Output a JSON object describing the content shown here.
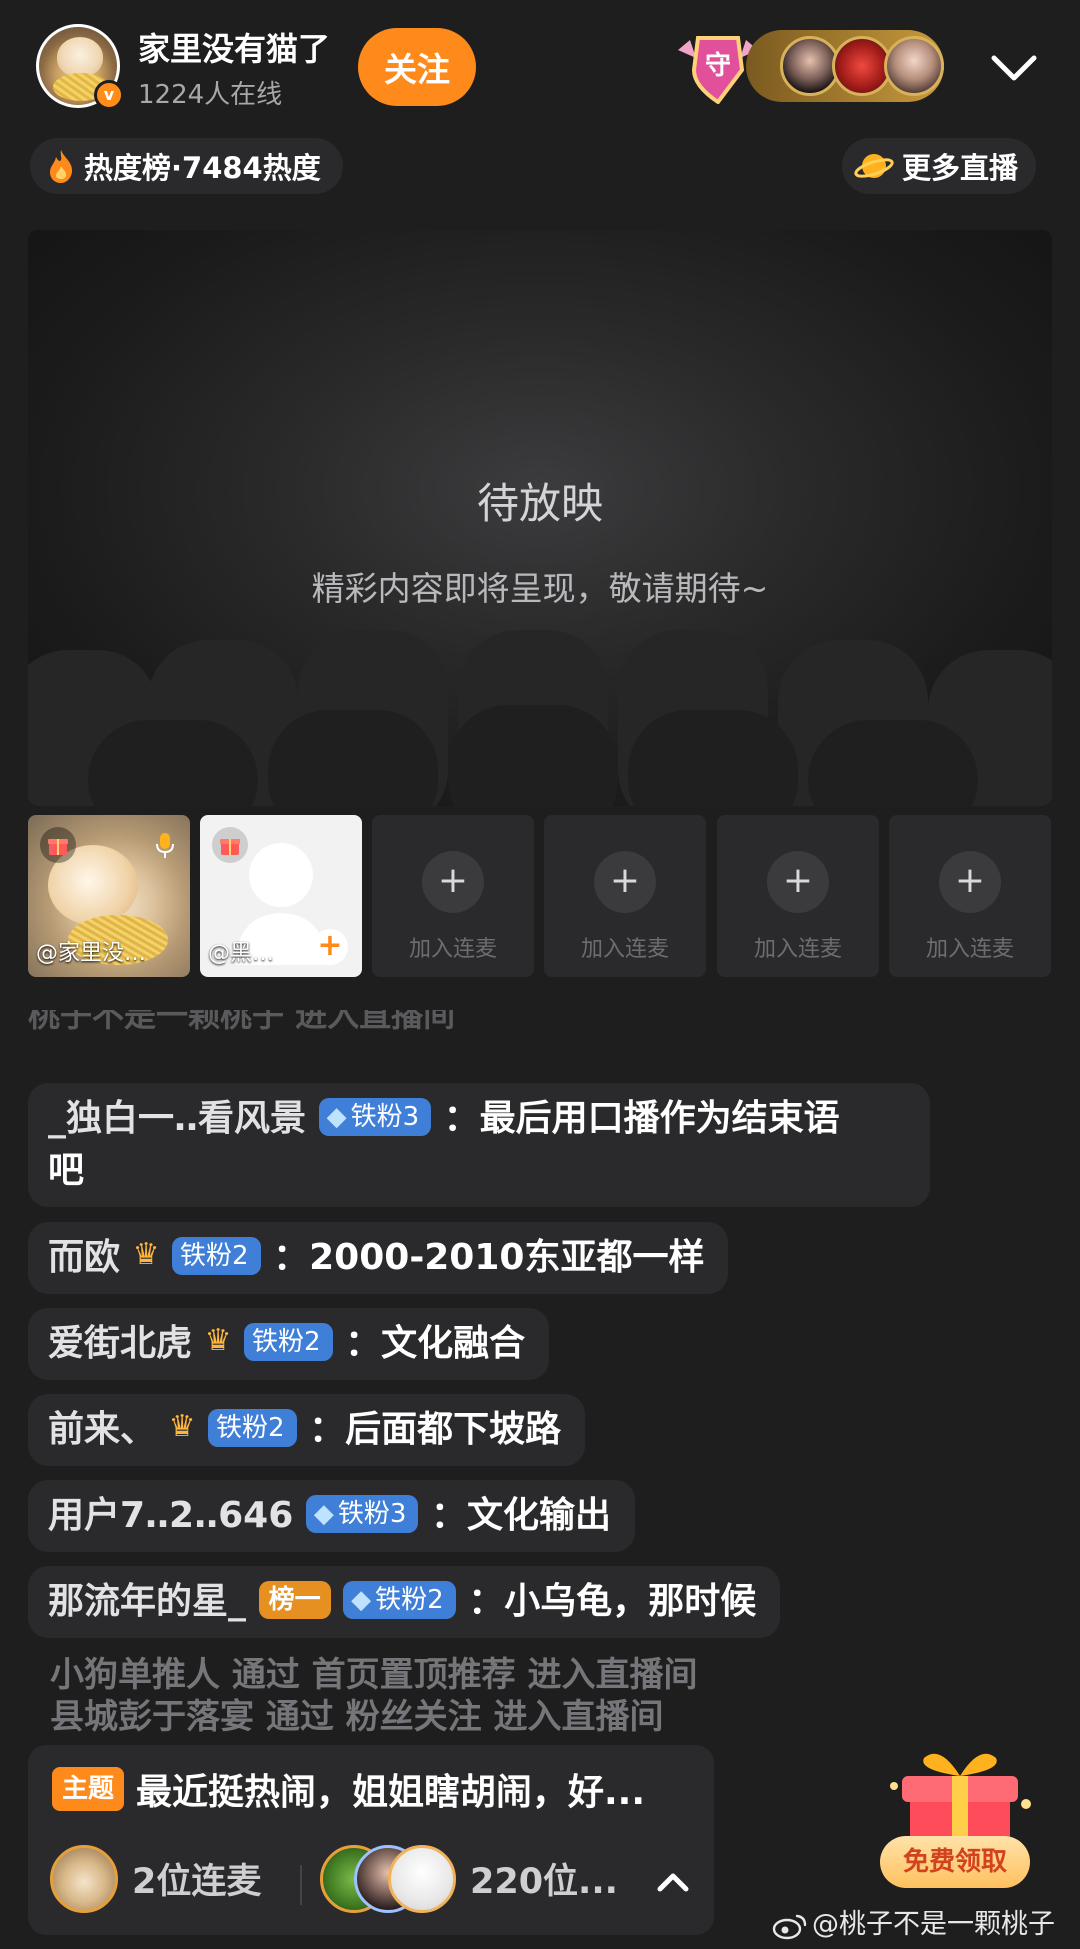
{
  "header": {
    "host_name": "家里没有猫了",
    "online_count": "1224人在线",
    "follow_label": "关注",
    "guard_label": "守"
  },
  "rank": {
    "hot_label": "热度榜·7484热度",
    "more_live_label": "更多直播"
  },
  "video": {
    "title": "待放映",
    "subtitle": "精彩内容即将呈现，敬请期待~"
  },
  "mic_slots": {
    "host_name": "@家里没…",
    "guest_name": "@黑…",
    "empty_label": "加入连麦"
  },
  "chat": {
    "faded_line": "桃子不是一颗桃子 进入直播间",
    "messages": [
      {
        "user": "_独白一‥看风景",
        "badge": "铁粉3",
        "text": "最后用口播作为结束语",
        "text2": "吧"
      },
      {
        "user": "而欧",
        "badge": "铁粉2",
        "text": "2000-2010东亚都一样"
      },
      {
        "user": "爱街北虎",
        "badge": "铁粉2",
        "text": "文化融合"
      },
      {
        "user": "前来、",
        "badge": "铁粉2",
        "text": "后面都下坡路"
      },
      {
        "user": "用户7‥2‥646",
        "badge": "铁粉3",
        "text": "文化输出"
      },
      {
        "user": "那流年的星_",
        "gold_badge": "榜一",
        "badge": "铁粉2",
        "text": "小乌龟，那时候"
      }
    ],
    "system_lines": [
      "小狗单推人 通过 首页置顶推荐 进入直播间",
      "县城彭于落宴 通过 粉丝关注 进入直播间"
    ],
    "separator": "："
  },
  "bottom": {
    "topic_tag": "主题",
    "topic_text": "最近挺热闹，姐姐瞎胡闹，好...",
    "mic_count": "2位连麦",
    "viewer_count": "220位..."
  },
  "gift": {
    "free_claim_label": "免费领取"
  },
  "watermark": "@桃子不是一颗桃子",
  "colors": {
    "background": "#1e1e1f",
    "accent_orange": "#ff8a1c",
    "fan_badge_blue": "#3f7fd8"
  }
}
